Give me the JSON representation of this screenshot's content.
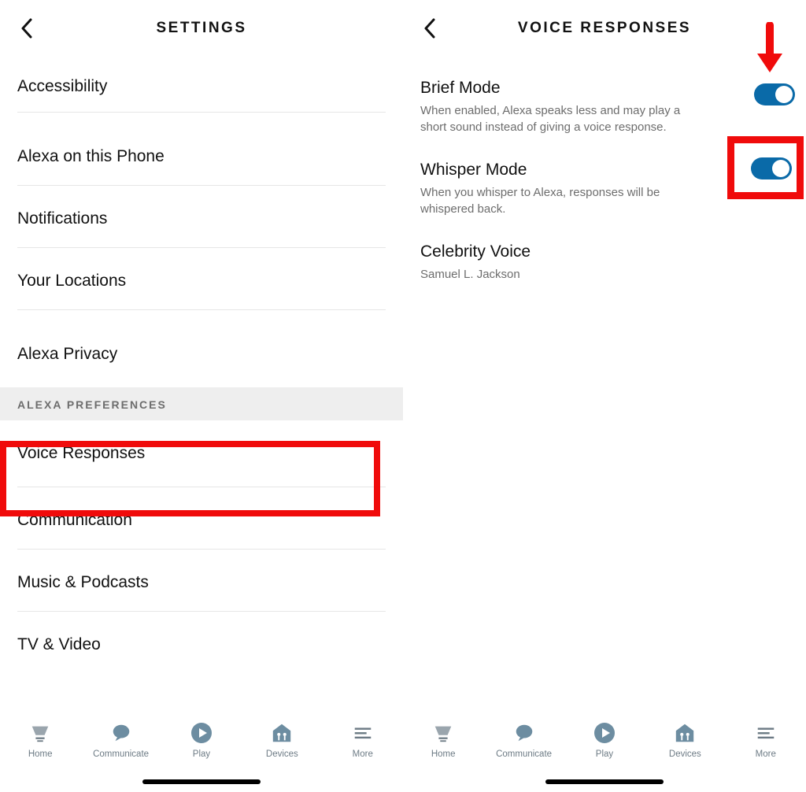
{
  "colors": {
    "accent": "#0a6aa8",
    "highlight": "#f00b0b",
    "muted": "#6d6d6d"
  },
  "left": {
    "header_title": "SETTINGS",
    "items": [
      {
        "label": "Accessibility"
      },
      {
        "label": "Alexa on this Phone"
      },
      {
        "label": "Notifications"
      },
      {
        "label": "Your Locations"
      },
      {
        "label": "Alexa Privacy"
      }
    ],
    "section_header": "ALEXA PREFERENCES",
    "pref_items": [
      {
        "label": "Voice Responses"
      },
      {
        "label": "Communication"
      },
      {
        "label": "Music & Podcasts"
      },
      {
        "label": "TV & Video"
      }
    ]
  },
  "right": {
    "header_title": "VOICE RESPONSES",
    "items": [
      {
        "title": "Brief Mode",
        "desc": "When enabled, Alexa speaks less and may play a short sound instead of giving a voice response.",
        "toggle_on": true
      },
      {
        "title": "Whisper Mode",
        "desc": "When you whisper to Alexa, responses will be whispered back.",
        "toggle_on": true
      },
      {
        "title": "Celebrity Voice",
        "desc": "Samuel L. Jackson"
      }
    ]
  },
  "nav": {
    "items": [
      {
        "label": "Home",
        "icon": "home-icon"
      },
      {
        "label": "Communicate",
        "icon": "communicate-icon"
      },
      {
        "label": "Play",
        "icon": "play-icon"
      },
      {
        "label": "Devices",
        "icon": "devices-icon"
      },
      {
        "label": "More",
        "icon": "more-icon"
      }
    ]
  }
}
